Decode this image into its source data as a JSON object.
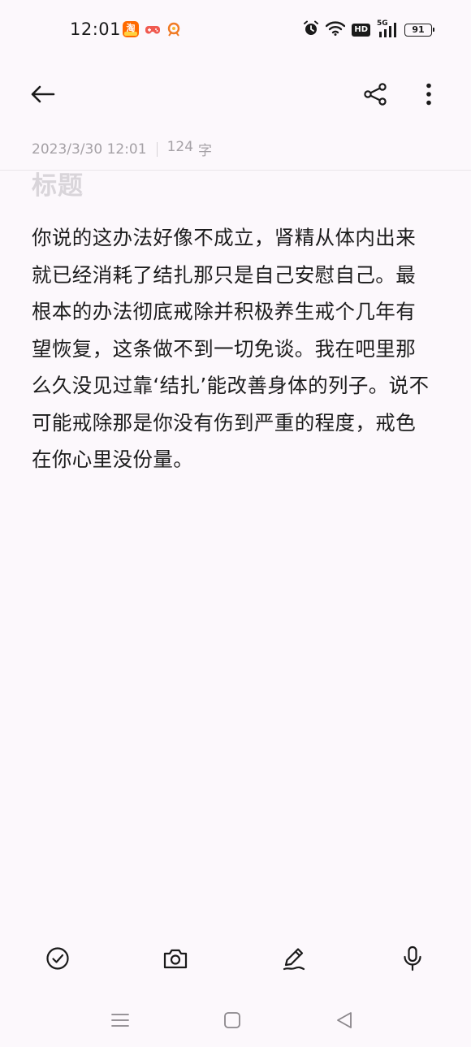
{
  "status_bar": {
    "time": "12:01",
    "network_label": "5G",
    "hd_label": "HD",
    "battery": "91",
    "notification_icons": [
      "taobao-app-icon",
      "game-controller-icon",
      "orange-app-icon"
    ],
    "system_icons": [
      "alarm-icon",
      "wifi-icon",
      "hd-icon",
      "signal-icon",
      "battery-icon"
    ]
  },
  "toolbar": {
    "back_icon": "arrow-left-icon",
    "share_icon": "share-icon",
    "more_icon": "more-vertical-icon"
  },
  "note": {
    "date": "2023/3/30 12:01",
    "word_count": "124",
    "word_unit": "字",
    "title_placeholder": "标题",
    "body": "你说的这办法好像不成立，肾精从体内出来就已经消耗了结扎那只是自己安慰自己。最根本的办法彻底戒除并积极养生戒个几年有望恢复，这条做不到一切免谈。我在吧里那么久没见过靠‘结扎’能改善身体的列子。说不可能戒除那是你没有伤到严重的程度，戒色在你心里没份量。"
  },
  "bottom_toolbar": {
    "items": [
      "checklist-icon",
      "camera-icon",
      "pen-icon",
      "microphone-icon"
    ]
  },
  "nav_bar": {
    "items": [
      "menu-icon",
      "home-icon",
      "back-triangle-icon"
    ]
  },
  "colors": {
    "background": "#fcf8fc",
    "text": "#1c1c1c",
    "meta_text": "#a5a1a6",
    "title_placeholder": "#d9d5da"
  }
}
